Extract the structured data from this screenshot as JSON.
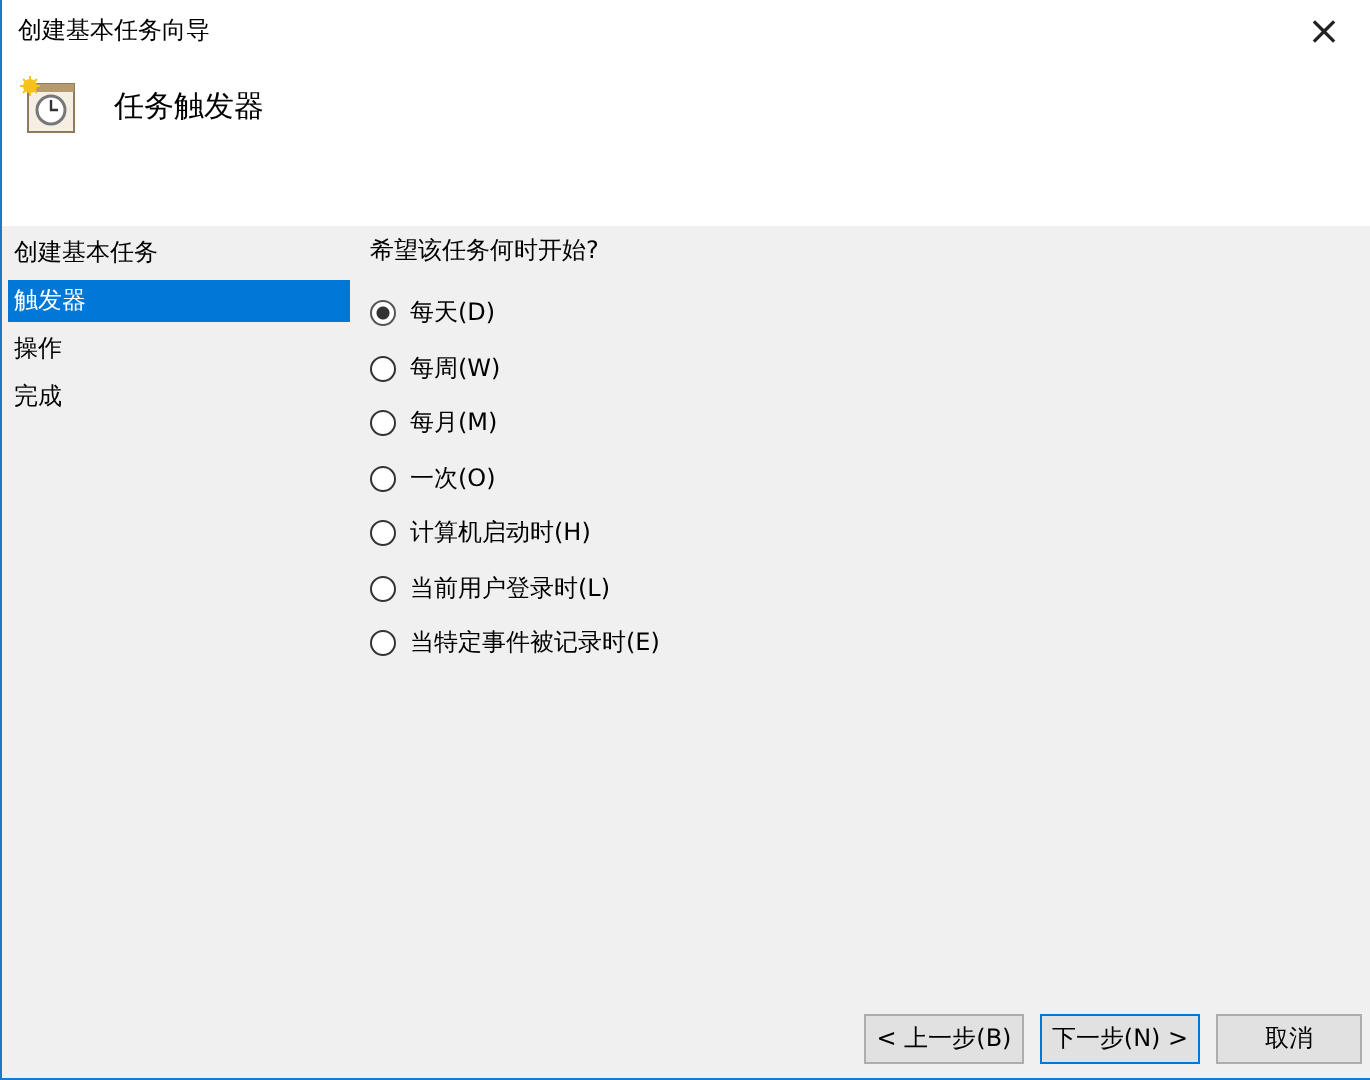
{
  "window": {
    "title": "创建基本任务向导",
    "close": "×"
  },
  "header": {
    "title": "任务触发器"
  },
  "sidebar": {
    "items": [
      {
        "label": "创建基本任务",
        "selected": false
      },
      {
        "label": "触发器",
        "selected": true
      },
      {
        "label": "操作",
        "selected": false
      },
      {
        "label": "完成",
        "selected": false
      }
    ]
  },
  "question": "希望该任务何时开始?",
  "options": [
    {
      "label": "每天(D)",
      "selected": true
    },
    {
      "label": "每周(W)",
      "selected": false
    },
    {
      "label": "每月(M)",
      "selected": false
    },
    {
      "label": "一次(O)",
      "selected": false
    },
    {
      "label": "计算机启动时(H)",
      "selected": false
    },
    {
      "label": "当前用户登录时(L)",
      "selected": false
    },
    {
      "label": "当特定事件被记录时(E)",
      "selected": false
    }
  ],
  "buttons": [
    {
      "label": "< 上一步(B)",
      "kind": "normal"
    },
    {
      "label": "下一步(N) >",
      "kind": "default"
    },
    {
      "label": "取消",
      "kind": "normal"
    }
  ]
}
